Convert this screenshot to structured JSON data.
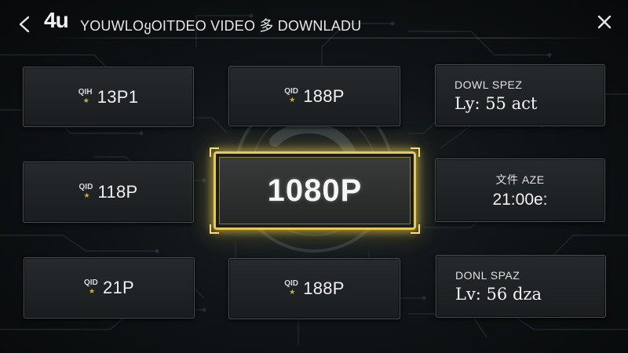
{
  "header": {
    "back_icon": "chevron-left-icon",
    "logo": "4u",
    "title": "YOUWLOყOITDEO VIDEO 多 DOWNLADU",
    "close_icon": "close-icon"
  },
  "quality_tiles": [
    {
      "tag": "QIH",
      "label": "13P1"
    },
    {
      "tag": "QID",
      "label": "188P"
    },
    {
      "tag": "QID",
      "label": "118P"
    },
    {
      "tag": "QID",
      "label": "21P"
    },
    {
      "tag": "QID",
      "label": "188P"
    }
  ],
  "selected_quality": {
    "label": "1080P"
  },
  "info_tiles": [
    {
      "title": "DOWL SPEZ",
      "value": "Ly: 55 act"
    },
    {
      "title": "文件 AZE",
      "value": "21:00e:"
    },
    {
      "title": "DONL SPAZ",
      "value": "Lv: 56 dza"
    }
  ],
  "colors": {
    "accent": "#e3c95a",
    "background": "#0b0d0f",
    "tile_border": "#4a4f53",
    "circuit": "#2b3a3f"
  }
}
